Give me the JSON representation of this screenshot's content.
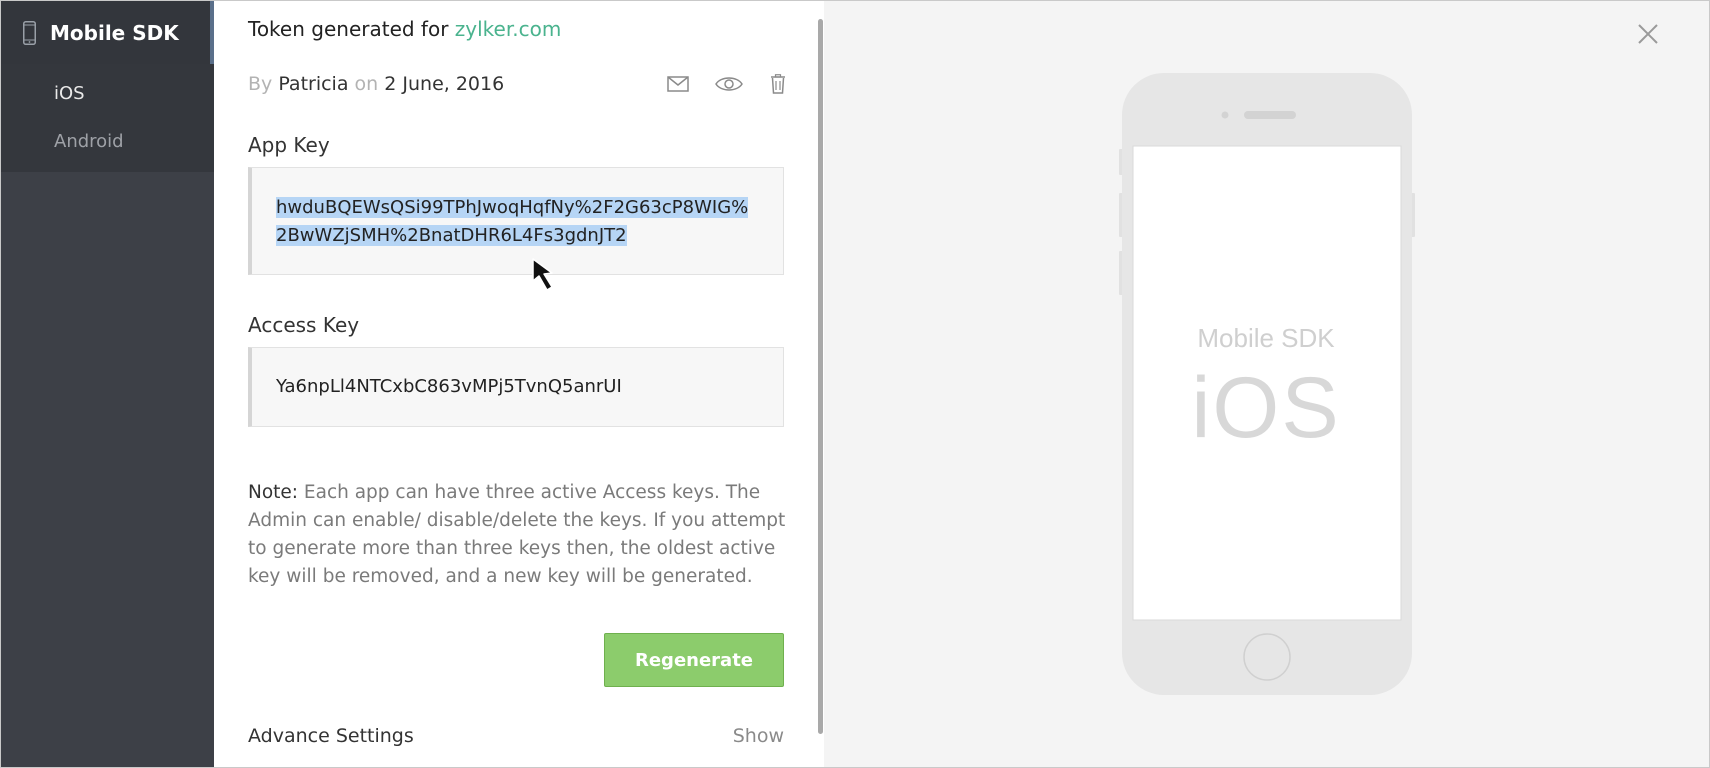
{
  "sidebar": {
    "title": "Mobile SDK",
    "items": [
      {
        "label": "iOS",
        "active": true
      },
      {
        "label": "Android",
        "active": false
      }
    ]
  },
  "token": {
    "prefix": "Token generated for",
    "domain": "zylker.com",
    "by_label": "By",
    "author": "Patricia",
    "on_label": "on",
    "date": "2 June, 2016"
  },
  "actions": {
    "email_icon": "envelope-icon",
    "view_icon": "eye-icon",
    "delete_icon": "trash-icon"
  },
  "app_key": {
    "label": "App Key",
    "value": "hwduBQEWsQSi99TPhJwoqHqfNy%2F2G63cP8WIG%2BwWZjSMH%2BnatDHR6L4Fs3gdnJT2"
  },
  "access_key": {
    "label": "Access Key",
    "value": "Ya6npLl4NTCxbC863vMPj5TvnQ5anrUI"
  },
  "note": {
    "label": "Note:",
    "text": "Each app can have three active Access keys. The Admin can enable/ disable/delete the keys. If you attempt to generate more than three keys then, the oldest active key will be removed, and a new key will be generated."
  },
  "buttons": {
    "regenerate": "Regenerate"
  },
  "advanced": {
    "label": "Advance Settings",
    "toggle": "Show"
  },
  "preview": {
    "line1": "Mobile SDK",
    "line2": "iOS"
  },
  "colors": {
    "sidebar_bg": "#3d4047",
    "accent_green": "#8ccc6c",
    "link_green": "#4ab38e",
    "selection": "#b6d5f5"
  }
}
